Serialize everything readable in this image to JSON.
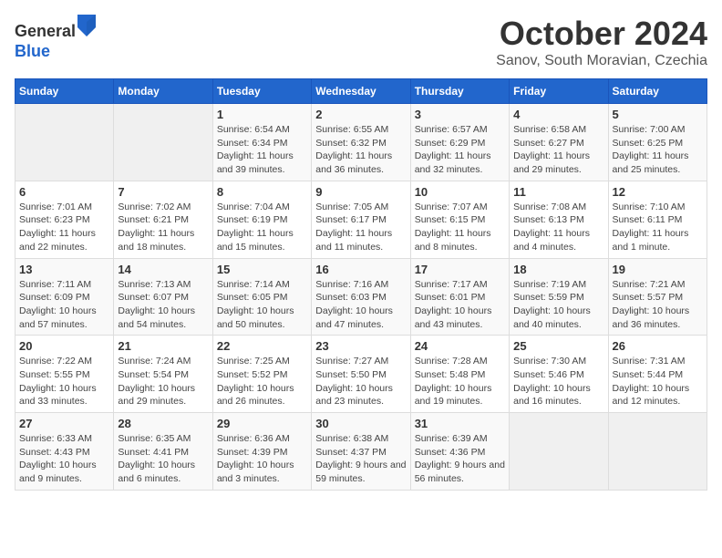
{
  "header": {
    "logo_line1": "General",
    "logo_line2": "Blue",
    "month": "October 2024",
    "location": "Sanov, South Moravian, Czechia"
  },
  "days_of_week": [
    "Sunday",
    "Monday",
    "Tuesday",
    "Wednesday",
    "Thursday",
    "Friday",
    "Saturday"
  ],
  "weeks": [
    [
      {
        "day": "",
        "info": ""
      },
      {
        "day": "",
        "info": ""
      },
      {
        "day": "1",
        "info": "Sunrise: 6:54 AM\nSunset: 6:34 PM\nDaylight: 11 hours and 39 minutes."
      },
      {
        "day": "2",
        "info": "Sunrise: 6:55 AM\nSunset: 6:32 PM\nDaylight: 11 hours and 36 minutes."
      },
      {
        "day": "3",
        "info": "Sunrise: 6:57 AM\nSunset: 6:29 PM\nDaylight: 11 hours and 32 minutes."
      },
      {
        "day": "4",
        "info": "Sunrise: 6:58 AM\nSunset: 6:27 PM\nDaylight: 11 hours and 29 minutes."
      },
      {
        "day": "5",
        "info": "Sunrise: 7:00 AM\nSunset: 6:25 PM\nDaylight: 11 hours and 25 minutes."
      }
    ],
    [
      {
        "day": "6",
        "info": "Sunrise: 7:01 AM\nSunset: 6:23 PM\nDaylight: 11 hours and 22 minutes."
      },
      {
        "day": "7",
        "info": "Sunrise: 7:02 AM\nSunset: 6:21 PM\nDaylight: 11 hours and 18 minutes."
      },
      {
        "day": "8",
        "info": "Sunrise: 7:04 AM\nSunset: 6:19 PM\nDaylight: 11 hours and 15 minutes."
      },
      {
        "day": "9",
        "info": "Sunrise: 7:05 AM\nSunset: 6:17 PM\nDaylight: 11 hours and 11 minutes."
      },
      {
        "day": "10",
        "info": "Sunrise: 7:07 AM\nSunset: 6:15 PM\nDaylight: 11 hours and 8 minutes."
      },
      {
        "day": "11",
        "info": "Sunrise: 7:08 AM\nSunset: 6:13 PM\nDaylight: 11 hours and 4 minutes."
      },
      {
        "day": "12",
        "info": "Sunrise: 7:10 AM\nSunset: 6:11 PM\nDaylight: 11 hours and 1 minute."
      }
    ],
    [
      {
        "day": "13",
        "info": "Sunrise: 7:11 AM\nSunset: 6:09 PM\nDaylight: 10 hours and 57 minutes."
      },
      {
        "day": "14",
        "info": "Sunrise: 7:13 AM\nSunset: 6:07 PM\nDaylight: 10 hours and 54 minutes."
      },
      {
        "day": "15",
        "info": "Sunrise: 7:14 AM\nSunset: 6:05 PM\nDaylight: 10 hours and 50 minutes."
      },
      {
        "day": "16",
        "info": "Sunrise: 7:16 AM\nSunset: 6:03 PM\nDaylight: 10 hours and 47 minutes."
      },
      {
        "day": "17",
        "info": "Sunrise: 7:17 AM\nSunset: 6:01 PM\nDaylight: 10 hours and 43 minutes."
      },
      {
        "day": "18",
        "info": "Sunrise: 7:19 AM\nSunset: 5:59 PM\nDaylight: 10 hours and 40 minutes."
      },
      {
        "day": "19",
        "info": "Sunrise: 7:21 AM\nSunset: 5:57 PM\nDaylight: 10 hours and 36 minutes."
      }
    ],
    [
      {
        "day": "20",
        "info": "Sunrise: 7:22 AM\nSunset: 5:55 PM\nDaylight: 10 hours and 33 minutes."
      },
      {
        "day": "21",
        "info": "Sunrise: 7:24 AM\nSunset: 5:54 PM\nDaylight: 10 hours and 29 minutes."
      },
      {
        "day": "22",
        "info": "Sunrise: 7:25 AM\nSunset: 5:52 PM\nDaylight: 10 hours and 26 minutes."
      },
      {
        "day": "23",
        "info": "Sunrise: 7:27 AM\nSunset: 5:50 PM\nDaylight: 10 hours and 23 minutes."
      },
      {
        "day": "24",
        "info": "Sunrise: 7:28 AM\nSunset: 5:48 PM\nDaylight: 10 hours and 19 minutes."
      },
      {
        "day": "25",
        "info": "Sunrise: 7:30 AM\nSunset: 5:46 PM\nDaylight: 10 hours and 16 minutes."
      },
      {
        "day": "26",
        "info": "Sunrise: 7:31 AM\nSunset: 5:44 PM\nDaylight: 10 hours and 12 minutes."
      }
    ],
    [
      {
        "day": "27",
        "info": "Sunrise: 6:33 AM\nSunset: 4:43 PM\nDaylight: 10 hours and 9 minutes."
      },
      {
        "day": "28",
        "info": "Sunrise: 6:35 AM\nSunset: 4:41 PM\nDaylight: 10 hours and 6 minutes."
      },
      {
        "day": "29",
        "info": "Sunrise: 6:36 AM\nSunset: 4:39 PM\nDaylight: 10 hours and 3 minutes."
      },
      {
        "day": "30",
        "info": "Sunrise: 6:38 AM\nSunset: 4:37 PM\nDaylight: 9 hours and 59 minutes."
      },
      {
        "day": "31",
        "info": "Sunrise: 6:39 AM\nSunset: 4:36 PM\nDaylight: 9 hours and 56 minutes."
      },
      {
        "day": "",
        "info": ""
      },
      {
        "day": "",
        "info": ""
      }
    ]
  ]
}
